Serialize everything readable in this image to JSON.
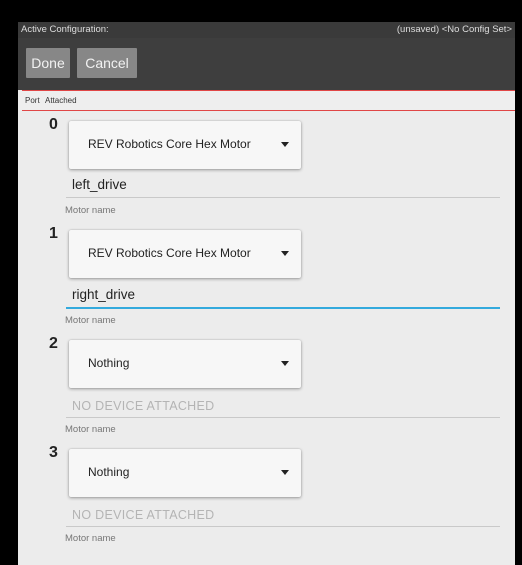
{
  "status_bar": {
    "title": "Active Configuration:",
    "status": "(unsaved) <No Config Set>"
  },
  "actions": {
    "done_label": "Done",
    "cancel_label": "Cancel"
  },
  "table_header": {
    "port": "Port",
    "attached": "Attached"
  },
  "ports": [
    {
      "port": "0",
      "device": "REV Robotics Core Hex Motor",
      "name": "left_drive",
      "name_hint": "Motor name",
      "focused": false
    },
    {
      "port": "1",
      "device": "REV Robotics Core Hex Motor",
      "name": "right_drive",
      "name_hint": "Motor name",
      "focused": true
    },
    {
      "port": "2",
      "device": "Nothing",
      "name": "NO DEVICE ATTACHED",
      "name_hint": "Motor name",
      "focused": false
    },
    {
      "port": "3",
      "device": "Nothing",
      "name": "NO DEVICE ATTACHED",
      "name_hint": "Motor name",
      "focused": false
    }
  ],
  "colors": {
    "action_bar": "#3e3e3e",
    "button": "#878787",
    "divider_red": "#e04646",
    "focus_blue": "#33aadd"
  }
}
